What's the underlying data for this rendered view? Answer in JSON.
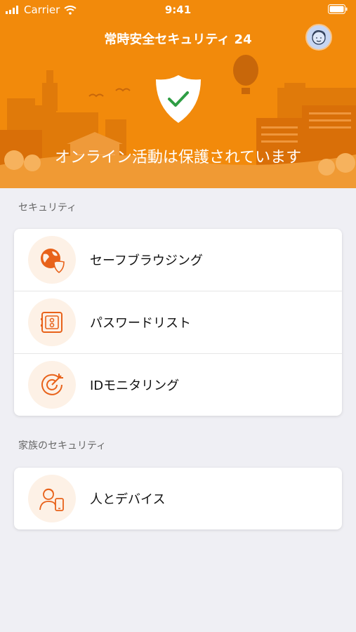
{
  "status_bar": {
    "carrier": "Carrier",
    "time": "9:41"
  },
  "header": {
    "title": "常時安全セキュリティ 24",
    "status_message": "オンライン活動は保護されています"
  },
  "sections": [
    {
      "label": "セキュリティ",
      "items": [
        {
          "label": "セーフブラウジング",
          "icon": "globe-shield-icon"
        },
        {
          "label": "パスワードリスト",
          "icon": "vault-icon"
        },
        {
          "label": "IDモニタリング",
          "icon": "target-icon"
        }
      ]
    },
    {
      "label": "家族のセキュリティ",
      "items": [
        {
          "label": "人とデバイス",
          "icon": "person-device-icon"
        }
      ]
    }
  ],
  "colors": {
    "brand_orange": "#f28a0b",
    "icon_orange": "#e8621a",
    "check_green": "#2e9d44"
  }
}
